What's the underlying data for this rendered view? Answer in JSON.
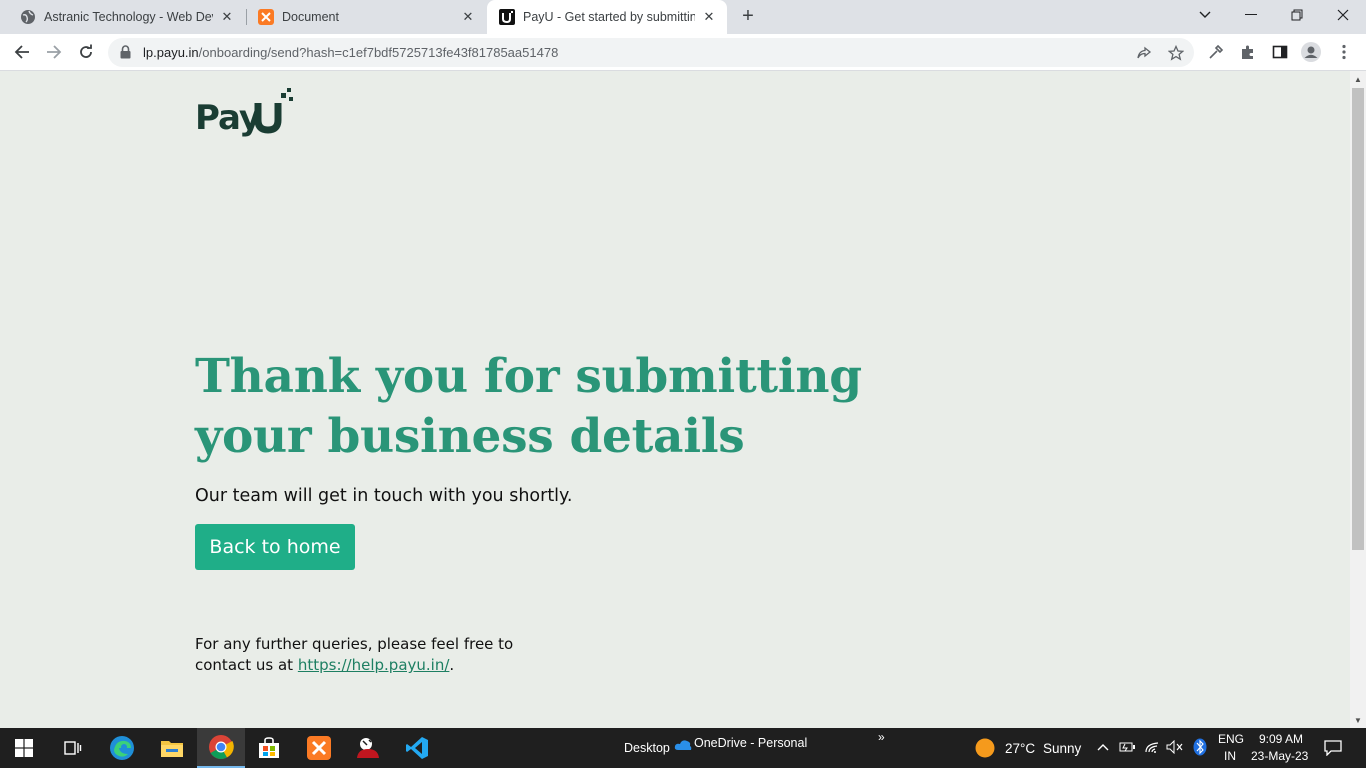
{
  "browser": {
    "tabs": [
      {
        "title": "Astranic Technology - Web Devel",
        "icon": "globe-icon"
      },
      {
        "title": "Document",
        "icon": "xampp-icon"
      },
      {
        "title": "PayU - Get started by submitting",
        "icon": "payu-icon"
      }
    ],
    "url_host": "lp.payu.in",
    "url_path": "/onboarding/send?hash=c1ef7bdf5725713fe43f81785aa51478"
  },
  "page": {
    "logo_text": "PayU",
    "headline": "Thank you for submitting your business details",
    "subtext": "Our team will get in touch with you shortly.",
    "button_label": "Back to home",
    "queries_text": "For any further queries, please feel free to contact us at ",
    "help_link": "https://help.payu.in/",
    "queries_end": "."
  },
  "taskbar": {
    "desktop_label": "Desktop",
    "onedrive_label": "OneDrive - Personal",
    "weather_temp": "27°C",
    "weather_desc": "Sunny",
    "lang_top": "ENG",
    "lang_bottom": "IN",
    "time": "9:09 AM",
    "date": "23-May-23"
  },
  "colors": {
    "headline": "#2a9578",
    "button": "#1fae88",
    "page_bg": "#e9ede8",
    "logo": "#1a3d33"
  }
}
